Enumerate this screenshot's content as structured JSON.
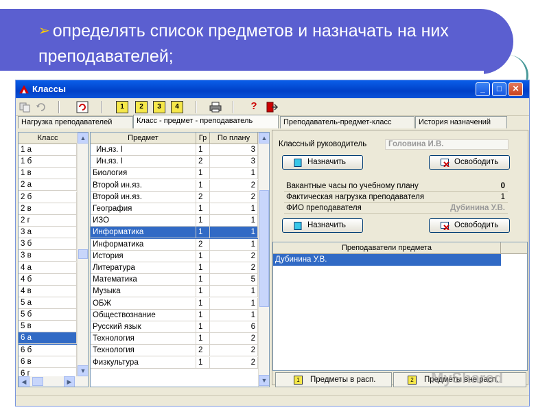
{
  "slide": {
    "bullet_symbol": "➢",
    "text": "определять список предметов и назначать на них преподавателей;"
  },
  "window": {
    "title": "Классы",
    "controls": {
      "minimize": "_",
      "maximize": "□",
      "close": "✕"
    }
  },
  "toolbar": {
    "icons": [
      "copy-icon",
      "undo-icon",
      "refresh-icon",
      "doc-1-icon",
      "doc-2-icon",
      "doc-3-icon",
      "doc-4-icon",
      "print-icon",
      "help-icon",
      "exit-icon"
    ],
    "box_labels": [
      "1",
      "2",
      "3",
      "4"
    ],
    "help_label": "?"
  },
  "tabs": [
    {
      "label": "Нагрузка преподавателей"
    },
    {
      "label": "Класс - предмет - преподаватель"
    },
    {
      "label": "Преподаватель-предмет-класс"
    },
    {
      "label": "История назначений"
    }
  ],
  "class_list": {
    "header": "Класс",
    "selected": "6 а",
    "items": [
      "1 а",
      "1 б",
      "1 в",
      "2 а",
      "2 б",
      "2 в",
      "2 г",
      "3 а",
      "3 б",
      "3 в",
      "4 а",
      "4 б",
      "4 в",
      "5 а",
      "5 б",
      "5 в",
      "6 а",
      "6 б",
      "6 в",
      "6 г"
    ]
  },
  "subjects": {
    "headers": {
      "subject": "Предмет",
      "group": "Гр",
      "plan": "По плану"
    },
    "selected": "Информатика",
    "rows": [
      {
        "subject": "Ин.яз. I",
        "group": "1",
        "plan": "3"
      },
      {
        "subject": "Ин.яз. I",
        "group": "2",
        "plan": "3"
      },
      {
        "subject": "Биология",
        "group": "1",
        "plan": "1"
      },
      {
        "subject": "Второй ин.яз.",
        "group": "1",
        "plan": "2"
      },
      {
        "subject": "Второй ин.яз.",
        "group": "2",
        "plan": "2"
      },
      {
        "subject": "География",
        "group": "1",
        "plan": "1"
      },
      {
        "subject": "ИЗО",
        "group": "1",
        "plan": "1"
      },
      {
        "subject": "Информатика",
        "group": "1",
        "plan": "1"
      },
      {
        "subject": "Информатика",
        "group": "2",
        "plan": "1"
      },
      {
        "subject": "История",
        "group": "1",
        "plan": "2"
      },
      {
        "subject": "Литература",
        "group": "1",
        "plan": "2"
      },
      {
        "subject": "Математика",
        "group": "1",
        "plan": "5"
      },
      {
        "subject": "Музыка",
        "group": "1",
        "plan": "1"
      },
      {
        "subject": "ОБЖ",
        "group": "1",
        "plan": "1"
      },
      {
        "subject": "Обществознание",
        "group": "1",
        "plan": "1"
      },
      {
        "subject": "Русский язык",
        "group": "1",
        "plan": "6"
      },
      {
        "subject": "Технология",
        "group": "1",
        "plan": "2"
      },
      {
        "subject": "Технология",
        "group": "2",
        "plan": "2"
      },
      {
        "subject": "Физкультура",
        "group": "1",
        "plan": "2"
      }
    ]
  },
  "class_teacher": {
    "label": "Классный руководитель",
    "value": "Головина И.В.",
    "assign_label": "Назначить",
    "release_label": "Освободить"
  },
  "load_info": {
    "rows": [
      {
        "label": "Вакантные часы по учебному плану",
        "value": "0"
      },
      {
        "label": "Фактическая нагрузка преподавателя",
        "value": "1"
      }
    ],
    "teacher_label": "ФИО преподавателя",
    "teacher_value": "Дубинина У.В.",
    "assign_label": "Назначить",
    "release_label": "Освободить"
  },
  "teachers_list": {
    "header": "Преподаватели предмета",
    "items": [
      "Дубинина У.В."
    ]
  },
  "bottom_buttons": [
    {
      "icon_label": "1",
      "label": "Предметы в расп."
    },
    {
      "icon_label": "2",
      "label": "Предметы вне расп."
    }
  ],
  "watermark": "MyShared"
}
